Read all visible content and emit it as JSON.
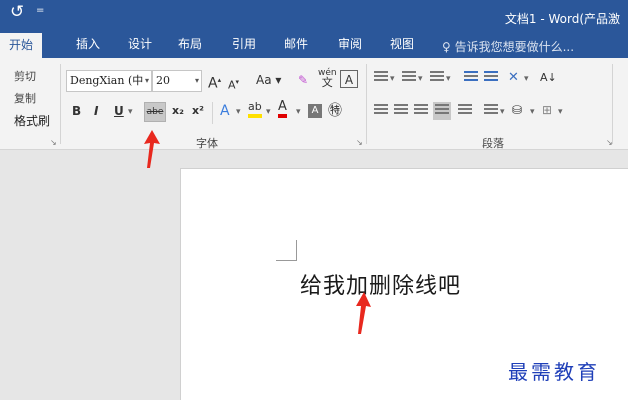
{
  "app": {
    "title": "文档1 - Word(产品激",
    "undo_icon": "↺",
    "qat_more": "="
  },
  "tabs": [
    {
      "label": "开始",
      "active": true
    },
    {
      "label": "插入"
    },
    {
      "label": "设计"
    },
    {
      "label": "布局"
    },
    {
      "label": "引用"
    },
    {
      "label": "邮件"
    },
    {
      "label": "审阅"
    },
    {
      "label": "视图"
    }
  ],
  "tell_me": "♀ 告诉我您想要做什么...",
  "clipboard": {
    "cut": "剪切",
    "copy": "复制",
    "format_painter": "格式刷"
  },
  "font_group": {
    "font_name": "DengXian (中",
    "font_size": "20",
    "grow_font": "A",
    "shrink_font": "A",
    "change_case": "Aa",
    "clear_format": "✎",
    "phonetic": "wén",
    "char_border": "A",
    "bold": "B",
    "italic": "I",
    "underline": "U",
    "strikethrough": "abe",
    "subscript": "x₂",
    "superscript": "x²",
    "text_effects": "A",
    "highlight": "ab",
    "font_color": "A",
    "char_shading": "A",
    "enclose": "㊕",
    "label": "字体",
    "launcher": "↘"
  },
  "paragraph_group": {
    "sort": "A↓",
    "label": "段落",
    "launcher": "↘"
  },
  "document": {
    "text": "给我加删除线吧"
  },
  "watermark": "最需教育",
  "colors": {
    "word_blue": "#2b579a",
    "ribbon_bg": "#f3f3f3",
    "arrow_red": "#e8281e",
    "watermark_blue": "#1f3fb8"
  }
}
